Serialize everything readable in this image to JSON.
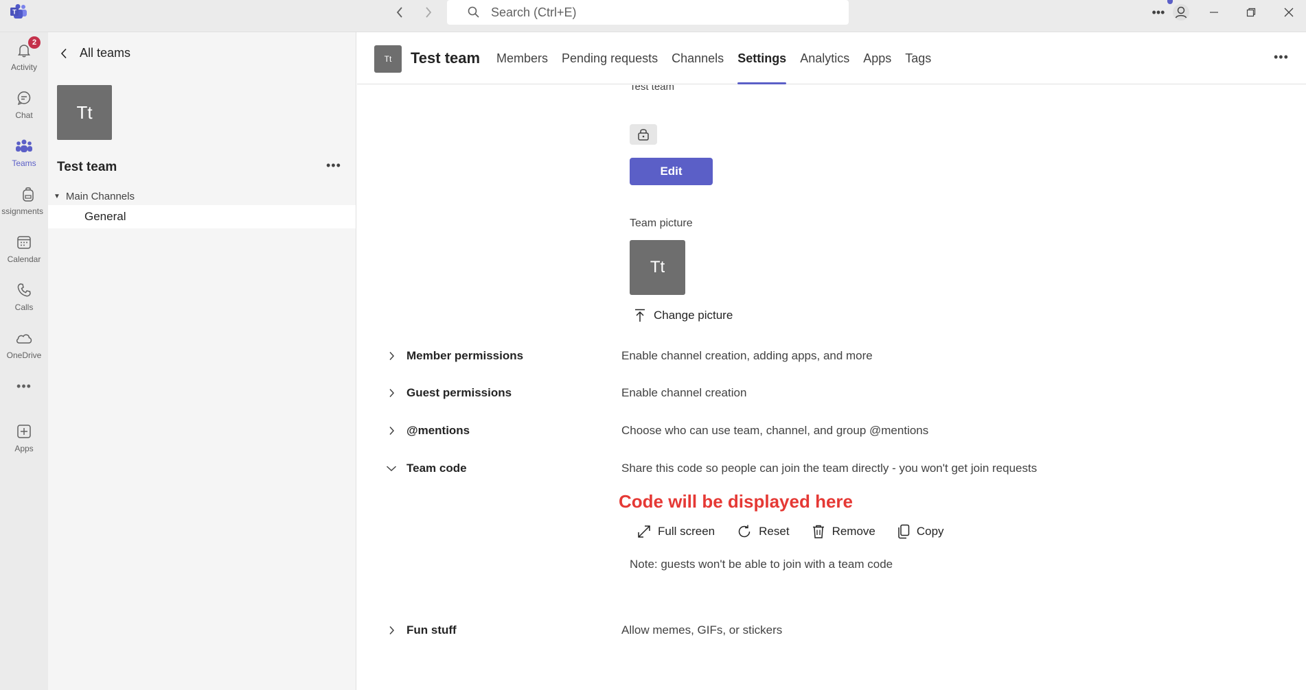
{
  "titlebar": {
    "search_placeholder": "Search (Ctrl+E)"
  },
  "rail": {
    "items": [
      {
        "label": "Activity",
        "badge": "2"
      },
      {
        "label": "Chat"
      },
      {
        "label": "Teams"
      },
      {
        "label": "ssignments"
      },
      {
        "label": "Calendar"
      },
      {
        "label": "Calls"
      },
      {
        "label": "OneDrive"
      },
      {
        "label": "Apps"
      }
    ]
  },
  "left_panel": {
    "back_label": "All teams",
    "avatar_initials": "Tt",
    "team_name": "Test team",
    "section_label": "Main Channels",
    "channels": [
      "General"
    ]
  },
  "header": {
    "avatar_initials": "Tt",
    "team_name": "Test team",
    "tabs": [
      "Members",
      "Pending requests",
      "Channels",
      "Settings",
      "Analytics",
      "Apps",
      "Tags"
    ],
    "active_tab": "Settings"
  },
  "content": {
    "cut_text": "Test team",
    "edit_label": "Edit",
    "team_picture_label": "Team picture",
    "picture_initials": "Tt",
    "change_picture_label": "Change picture",
    "settings": [
      {
        "name": "Member permissions",
        "desc": "Enable channel creation, adding apps, and more"
      },
      {
        "name": "Guest permissions",
        "desc": "Enable channel creation"
      },
      {
        "name": "@mentions",
        "desc": "Choose who can use team, channel, and group @mentions"
      },
      {
        "name": "Team code",
        "desc": "Share this code so people can join the team directly - you won't get join requests"
      },
      {
        "name": "Fun stuff",
        "desc": "Allow memes, GIFs, or stickers"
      }
    ],
    "code_placeholder": "Code will be displayed here",
    "code_actions": [
      "Full screen",
      "Reset",
      "Remove",
      "Copy"
    ],
    "note": "Note: guests won't be able to join with a team code"
  },
  "colors": {
    "accent": "#5b5fc7",
    "code_text": "#e53935",
    "avatar": "#6e6e6e"
  }
}
